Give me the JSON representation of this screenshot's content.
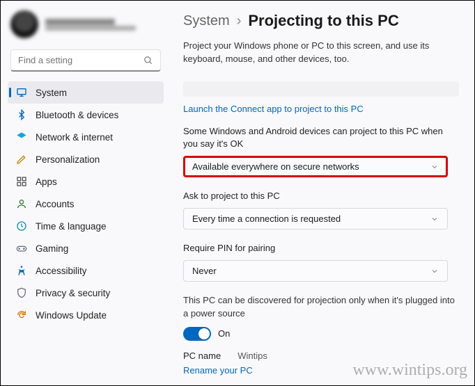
{
  "search": {
    "placeholder": "Find a setting"
  },
  "nav": {
    "system": "System",
    "bluetooth": "Bluetooth & devices",
    "network": "Network & internet",
    "personalization": "Personalization",
    "apps": "Apps",
    "accounts": "Accounts",
    "time": "Time & language",
    "gaming": "Gaming",
    "accessibility": "Accessibility",
    "privacy": "Privacy & security",
    "update": "Windows Update"
  },
  "breadcrumb": {
    "parent": "System",
    "separator": "›",
    "title": "Projecting to this PC"
  },
  "description": "Project your Windows phone or PC to this screen, and use its keyboard, mouse, and other devices, too.",
  "launch_link": "Launch the Connect app to project to this PC",
  "opt1": {
    "label": "Some Windows and Android devices can project to this PC when you say it's OK",
    "value": "Available everywhere on secure networks"
  },
  "opt2": {
    "label": "Ask to project to this PC",
    "value": "Every time a connection is requested"
  },
  "opt3": {
    "label": "Require PIN for pairing",
    "value": "Never"
  },
  "discovery_note": "This PC can be discovered for projection only when it's plugged into a power source",
  "toggle_label": "On",
  "pc_name_label": "PC name",
  "pc_name_value": "Wintips",
  "rename_link": "Rename your PC",
  "watermark": "www.wintips.org"
}
